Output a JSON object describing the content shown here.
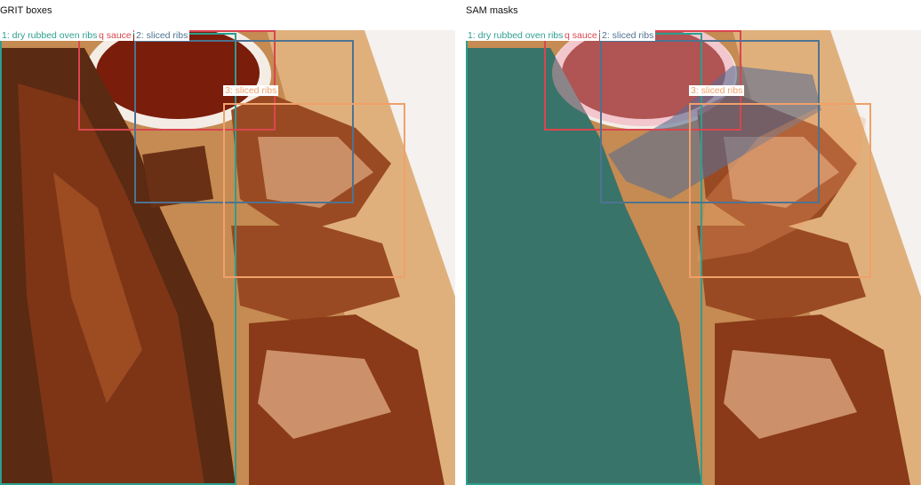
{
  "panels": {
    "left_title": "GRIT boxes",
    "right_title": "SAM masks"
  },
  "objects": [
    {
      "label": "1: dry rubbed oven ribs",
      "color": "#2e9e8f"
    },
    {
      "label": "q sauce",
      "color": "#d9464f"
    },
    {
      "label": "2: sliced ribs",
      "color": "#4f7291"
    },
    {
      "label": "3: sliced ribs",
      "color": "#f0a06a"
    }
  ],
  "masks": {
    "ribs_tint": "#2e8e88",
    "sauce_tint": "#f19ab0",
    "sliced2_tint": "#5a6e92"
  },
  "photo": {
    "board": "#c58b52",
    "board_light": "#e0b07c",
    "meat_dark": "#5a2a12",
    "meat_mid": "#9a4a22",
    "meat_light": "#d7a07a",
    "sauce": "#7a1d0a",
    "bowl": "#f3ede6"
  }
}
